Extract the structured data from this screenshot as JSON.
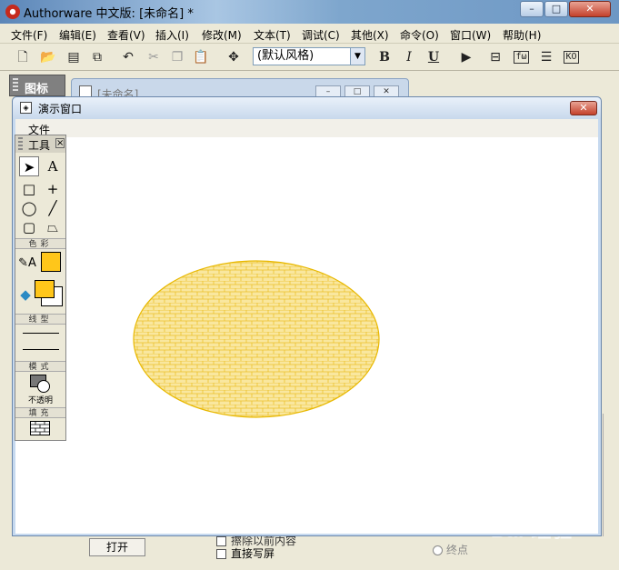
{
  "app": {
    "title": "Authorware 中文版: [未命名] *",
    "window_buttons": {
      "minimize": "–",
      "maximize": "□",
      "close": "✕"
    }
  },
  "menubar": {
    "items": [
      "文件(F)",
      "编辑(E)",
      "查看(V)",
      "插入(I)",
      "修改(M)",
      "文本(T)",
      "调试(C)",
      "其他(X)",
      "命令(O)",
      "窗口(W)",
      "帮助(H)"
    ]
  },
  "toolbar": {
    "style_select": "(默认风格)",
    "bold_label": "B",
    "italic_label": "I",
    "underline_label": "U",
    "fn_label": "fω",
    "ko_label": "KO"
  },
  "icon_palette": {
    "title": "图标"
  },
  "design_window": {
    "title": "[未命名]"
  },
  "presentation_window": {
    "title": "演示窗口",
    "menu_file": "文件",
    "ellipse": {
      "fill": "#f9e79f",
      "stroke": "#e8b800",
      "pattern": "brick"
    }
  },
  "tools_palette": {
    "title": "工具",
    "section_color": "色彩",
    "section_line": "线型",
    "section_mode": "模式",
    "mode_value": "不透明",
    "section_fill": "填充",
    "foreground_color": "#ffc61a",
    "background_color": "#ffffff"
  },
  "background_controls": {
    "open_button": "打开",
    "erase_checkbox": "擦除以前内容",
    "direct_checkbox": "直接写屏",
    "endpoint_radio": "终点"
  },
  "watermark": "Bai  经验"
}
